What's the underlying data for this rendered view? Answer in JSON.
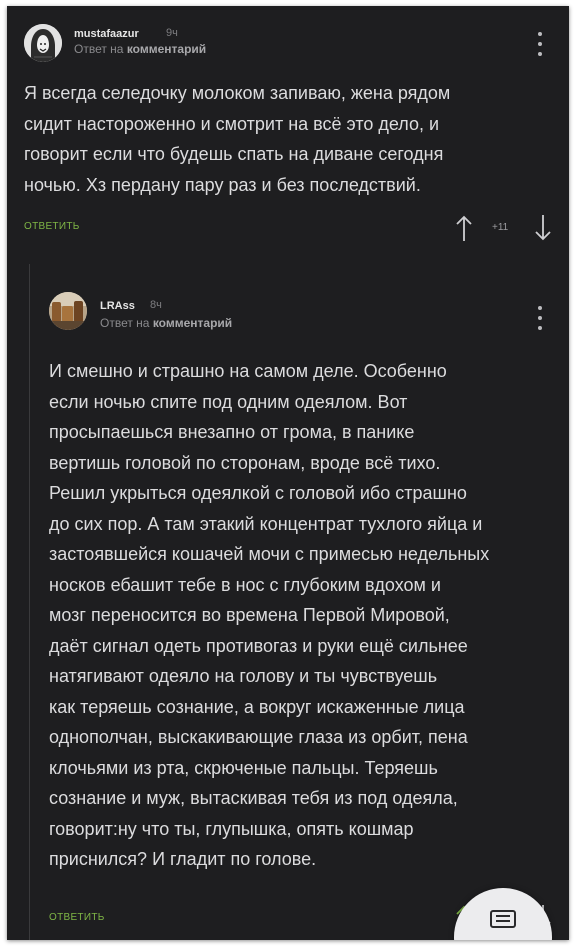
{
  "comments": [
    {
      "username": "mustafaazur",
      "time": "9ч",
      "reply_prefix": "Ответ на",
      "reply_target": "комментарий",
      "text": "Я всегда селедочку молоком запиваю, жена рядом\nсидит настороженно и смотрит на всё это дело, и\nговорит если что будешь спать на диване сегодня\nночью. Хз пердану пару раз и без последствий.",
      "reply_label": "ОТВЕТИТЬ",
      "score": "+11",
      "icons": [
        "avatar-hooded-figure",
        "more-vertical-icon",
        "arrow-up-icon",
        "arrow-down-icon"
      ]
    },
    {
      "username": "LRAss",
      "time": "8ч",
      "reply_prefix": "Ответ на",
      "reply_target": "комментарий",
      "text": "И смешно и страшно на самом деле. Особенно\nесли ночью спите под одним одеялом. Вот\nпросыпаешься внезапно от грома, в панике\nвертишь головой по сторонам, вроде всё тихо.\nРешил укрыться одеялкой с головой ибо страшно\nдо сих пор. А там этакий концентрат тухлого яйца и\nзастоявшейся кошачей мочи с примесью недельных\nносков ебашит тебе в нос с глубоким вдохом и\nмозг переносится во времена Первой Мировой,\nдаёт сигнал одеть противогаз и руки ещё сильнее\nнатягивают одеяло на голову и ты чувствуешь\nкак теряешь сознание, а вокруг искаженные лица\nоднополчан, выскакивающие глаза из орбит, пена\nклочьями из рта, скрюченые пальцы. Теряешь\nсознание и муж, вытаскивая тебя из под одеяла,\nговорит:ну что ты, глупышка, опять кошмар\nприснился? И гладит по голове.",
      "reply_label": "ОТВЕТИТЬ",
      "icons": [
        "avatar-photo",
        "more-vertical-icon",
        "arrow-up-icon",
        "arrow-down-icon"
      ]
    }
  ],
  "fab": {
    "icon": "comment-icon"
  },
  "colors": {
    "background": "#1e1e20",
    "text": "#dcdcde",
    "accent_green": "#7fb646",
    "muted": "#8a8a8d"
  }
}
